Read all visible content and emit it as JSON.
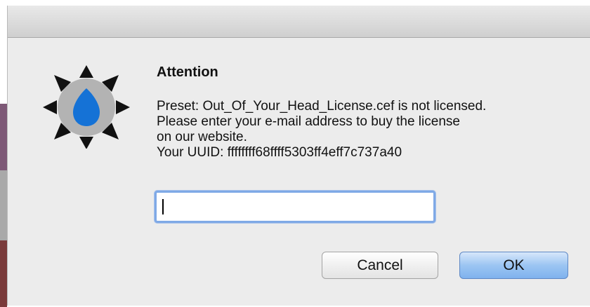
{
  "dialog": {
    "title": "Attention",
    "message_lines": [
      "Preset: Out_Of_Your_Head_License.cef is not licensed.",
      "Please enter your e-mail address to buy the license",
      "on our website.",
      "Your UUID: ffffffff68ffff5303ff4eff7c737a40"
    ],
    "email_input": {
      "value": "",
      "placeholder": ""
    },
    "buttons": {
      "cancel_label": "Cancel",
      "ok_label": "OK"
    },
    "icon": {
      "name": "sun-badge-icon",
      "colors": {
        "rays": "#111111",
        "disc": "#b3b3b3",
        "drop": "#1572d6"
      }
    },
    "colors": {
      "dialog_background": "#ececec",
      "default_button": "#9cc5f2",
      "focus_ring": "#7fa9e6"
    }
  }
}
